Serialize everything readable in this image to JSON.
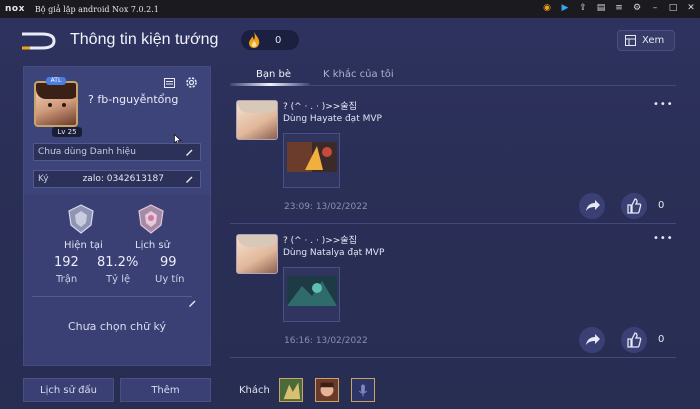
{
  "window": {
    "logo": "nox",
    "title": "Bộ giả lập android Nox 7.0.2.1",
    "icons": [
      "compass-icon",
      "play-icon",
      "share-icon",
      "message-icon",
      "menu-icon",
      "settings-icon",
      "minimize-icon",
      "maximize-icon",
      "close-icon"
    ]
  },
  "header": {
    "title": "Thông tin kiện tướng",
    "coins": "0",
    "view_button": "Xem"
  },
  "profile": {
    "rank_badge": "ATL",
    "level": "Lv 25",
    "name": "fb-nguyễntổng",
    "name_prefix": "?",
    "title_field": "Chưa dùng Danh hiệu",
    "sign_label": "Ký",
    "sign_value": "zalo: 0342613187"
  },
  "stats": {
    "current_label": "Hiện tại",
    "history_label": "Lịch sử",
    "matches_value": "192",
    "matches_label": "Trận",
    "ratio_value": "81.2%",
    "ratio_label": "Tỷ lệ",
    "prestige_value": "99",
    "prestige_label": "Uy tín",
    "signature": "Chưa chọn chữ ký"
  },
  "bottom_buttons": {
    "history": "Lịch sử đấu",
    "more": "Thêm"
  },
  "tabs": [
    {
      "label": "Bạn bè",
      "active": true
    },
    {
      "label": "K khắc của tôi",
      "active": false
    }
  ],
  "posts": [
    {
      "name": "? (^ · . · )>>술집",
      "text": "Dùng Hayate đạt MVP",
      "time": "23:09: 13/02/2022",
      "likes": "0",
      "more": "•••"
    },
    {
      "name": "? (^ · . · )>>술집",
      "text": "Dùng Natalya đạt MVP",
      "time": "16:16: 13/02/2022",
      "likes": "0",
      "more": "•••"
    }
  ],
  "guests": {
    "label": "Khách"
  },
  "colors": {
    "background": "#2b3058",
    "panel": "#3a4074",
    "accent_gold": "#c7a569",
    "titlebar": "#1b1b1f"
  }
}
